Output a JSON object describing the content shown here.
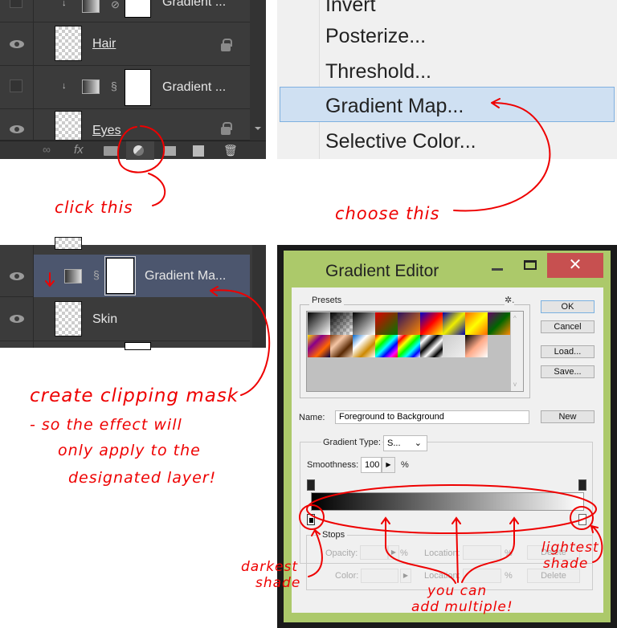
{
  "layers_top": {
    "rows": [
      {
        "name": "Gradient ...",
        "visible": false,
        "type": "gradient"
      },
      {
        "name": "Hair",
        "visible": true,
        "type": "pixel",
        "locked": true
      },
      {
        "name": "Gradient ...",
        "visible": false,
        "type": "gradient"
      },
      {
        "name": "Eyes",
        "visible": true,
        "type": "pixel",
        "locked": true
      }
    ],
    "bottom_icons": [
      "link-icon",
      "fx-icon",
      "mask-icon",
      "adjustment-layer-icon",
      "folder-icon",
      "new-layer-icon",
      "trash-icon"
    ],
    "fx_label": "fx"
  },
  "adjust_menu": {
    "items": [
      "Invert",
      "Posterize...",
      "Threshold...",
      "Gradient Map...",
      "Selective Color..."
    ],
    "highlighted": "Gradient Map..."
  },
  "layers_mid": {
    "rows": [
      {
        "name": "Gradient Ma...",
        "selected": true
      },
      {
        "name": "Skin"
      }
    ]
  },
  "editor": {
    "title": "Gradient Editor",
    "presets_label": "Presets",
    "ok": "OK",
    "cancel": "Cancel",
    "load": "Load...",
    "save": "Save...",
    "name_label": "Name:",
    "name_value": "Foreground to Background",
    "new": "New",
    "gradient_type_label": "Gradient Type:",
    "gradient_type_value": "S...",
    "smoothness_label": "Smoothness:",
    "smoothness_value": "100",
    "percent": "%",
    "stops_label": "Stops",
    "opacity_label": "Opacity:",
    "color_label": "Color:",
    "location_label": "Location:",
    "delete": "Delete",
    "presets": [
      [
        "#000",
        "#fff"
      ],
      [
        "#000",
        "transparent"
      ],
      [
        "#000",
        "#fff"
      ],
      [
        "#d00",
        "#070"
      ],
      [
        "#2a1060",
        "#f80"
      ],
      [
        "#00c",
        "#f00",
        "#ff0"
      ],
      [
        "#00a",
        "#ee0",
        "#00a"
      ],
      [
        "#f60",
        "#ff0",
        "#f60"
      ],
      [
        "#606",
        "#060",
        "#f80"
      ],
      [
        "#fd0",
        "#808",
        "#f60",
        "#004"
      ],
      [
        "#7a3a10",
        "#f5c6a5",
        "#5a2a05",
        "#f0d0b0"
      ],
      [
        "#06c",
        "#fff",
        "#c80",
        "#fff"
      ],
      [
        "#f00",
        "#ff0",
        "#0f0",
        "#0ff",
        "#00f",
        "#f0f",
        "#f00"
      ],
      [
        "#fff",
        "#f00",
        "#ff0",
        "#0f0",
        "#0ff",
        "#00f",
        "#fff"
      ],
      [
        "#000",
        "#fff",
        "#000",
        "#fff",
        "#000",
        "#fff"
      ],
      [
        "#ccc",
        "#eee"
      ],
      [
        "#000",
        "#fa8",
        "#fff"
      ]
    ]
  },
  "annotations": {
    "click": "click this",
    "choose": "choose this",
    "clip1": "create clipping mask",
    "clip2": "- so the effect will",
    "clip3": "only apply to the",
    "clip4": "designated layer!",
    "darkest1": "darkest",
    "darkest2": "shade",
    "lightest1": "lightest",
    "lightest2": "shade",
    "multi1": "you can",
    "multi2": "add multiple!",
    "color": "#ee0000"
  }
}
